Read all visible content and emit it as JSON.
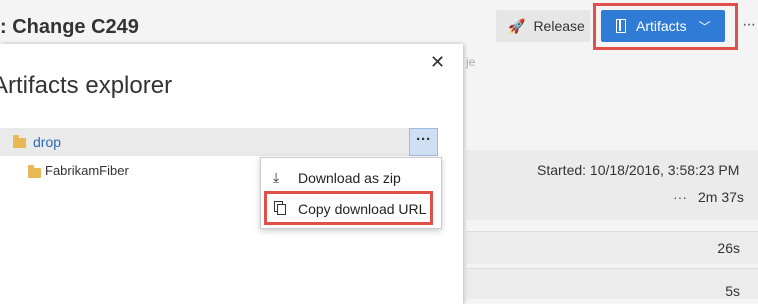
{
  "header": {
    "title": ": Change C249"
  },
  "toolbar": {
    "release_label": "Release",
    "release_icon": "rocket-icon",
    "artifacts_label": "Artifacts",
    "artifacts_icon": "artifact-icon",
    "more_label": "···"
  },
  "background": {
    "partial_text": "je",
    "started": "Started: 10/18/2016, 3:58:23 PM",
    "duration_dots": "···",
    "duration": "2m 37s",
    "rows": [
      {
        "value": "26s"
      },
      {
        "value": "5s"
      }
    ]
  },
  "panel": {
    "title": "Artifacts explorer",
    "close_glyph": "✕",
    "items": [
      {
        "label": "drop",
        "icon": "folder-icon",
        "more": "···"
      },
      {
        "label": "FabrikamFiber",
        "icon": "folder-icon"
      }
    ]
  },
  "context_menu": {
    "items": [
      {
        "label": "Download as zip",
        "icon": "download-icon",
        "glyph": "⤓"
      },
      {
        "label": "Copy download URL",
        "icon": "copy-icon"
      }
    ]
  },
  "colors": {
    "accent": "#2f7bd6",
    "highlight": "#e0504b",
    "folder": "#e8b756"
  }
}
